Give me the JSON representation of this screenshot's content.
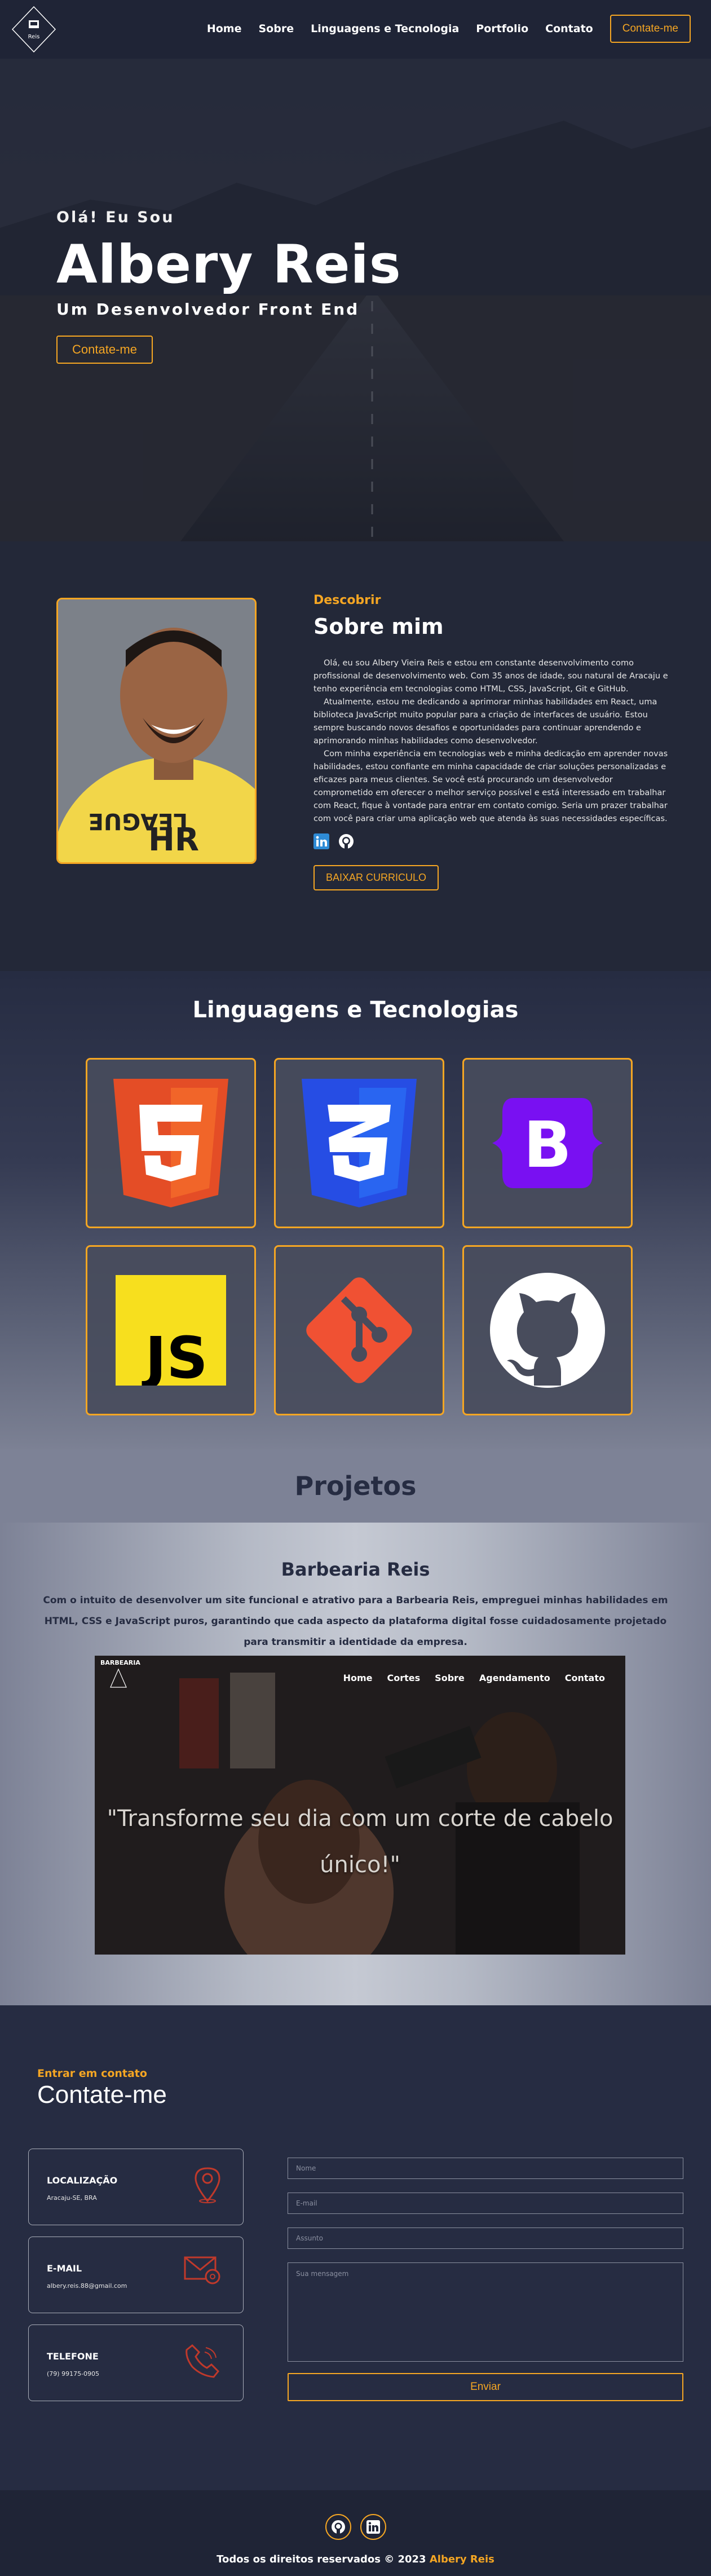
{
  "brand": {
    "logo_text": "Reis",
    "accent": "#f5a623",
    "dark": "#262c42"
  },
  "nav": {
    "items": [
      "Home",
      "Sobre",
      "Linguagens e Tecnologia",
      "Portfolio",
      "Contato"
    ],
    "cta": "Contate-me"
  },
  "hero": {
    "greeting": "Olá! Eu Sou",
    "name": "Albery Reis",
    "role": "Um Desenvolvedor Front End",
    "button": "Contate-me"
  },
  "about": {
    "tag": "Descobrir",
    "title": "Sobre mim",
    "paragraphs": [
      "Olá, eu sou Albery Vieira Reis e estou em constante desenvolvimento como profissional de desenvolvimento web. Com 35 anos de idade, sou natural de Aracaju e tenho experiência em tecnologias como HTML, CSS, JavaScript, Git e GitHub.",
      "Atualmente, estou me dedicando a aprimorar minhas habilidades em React, uma biblioteca JavaScript muito popular para a criação de interfaces de usuário. Estou sempre buscando novos desafios e oportunidades para continuar aprendendo e aprimorando minhas habilidades como desenvolvedor.",
      "Com minha experiência em tecnologias web e minha dedicação em aprender novas habilidades, estou confiante em minha capacidade de criar soluções personalizadas e eficazes para meus clientes. Se você está procurando um desenvolvedor comprometido em oferecer o melhor serviço possível e está interessado em trabalhar com React, fique à vontade para entrar em contato comigo. Seria um prazer trabalhar com você para criar uma aplicação web que atenda às suas necessidades específicas."
    ],
    "icons": [
      "linkedin-icon",
      "github-icon"
    ],
    "button": "BAIXAR CURRICULO"
  },
  "tech": {
    "title": "Linguagens e Tecnologias",
    "items": [
      "html5-icon",
      "css3-icon",
      "bootstrap-icon",
      "javascript-icon",
      "git-icon",
      "github-icon"
    ]
  },
  "projects": {
    "title": "Projetos",
    "project": {
      "name": "Barbearia Reis",
      "description": "Com o intuito de desenvolver um site funcional e atrativo para a Barbearia Reis, empreguei minhas habilidades em HTML, CSS e JavaScript puros, garantindo que cada aspecto da plataforma digital fosse cuidadosamente projetado para transmitir a identidade da empresa.",
      "screenshot": {
        "logo_text": "BARBEARIA",
        "nav": [
          "Home",
          "Cortes",
          "Sobre",
          "Agendamento",
          "Contato"
        ],
        "quote": "\"Transforme seu dia com um corte de cabelo único!\""
      }
    }
  },
  "contact": {
    "tag": "Entrar em contato",
    "title": "Contate-me",
    "cards": [
      {
        "title": "LOCALIZAÇÃO",
        "value": "Aracaju-SE, BRA",
        "icon": "location-pin-icon"
      },
      {
        "title": "E-MAIL",
        "value": "albery.reis.88@gmail.com",
        "icon": "envelope-icon"
      },
      {
        "title": "TELEFONE",
        "value": "(79) 99175-0905",
        "icon": "phone-icon"
      }
    ],
    "form": {
      "name_placeholder": "Nome",
      "email_placeholder": "E-mail",
      "subject_placeholder": "Assunto",
      "message_placeholder": "Sua mensagem",
      "submit": "Enviar"
    }
  },
  "footer": {
    "icons": [
      "github-icon",
      "linkedin-icon"
    ],
    "copyright": "Todos os direitos reservados © 2023",
    "owner": "Albery Reis"
  }
}
